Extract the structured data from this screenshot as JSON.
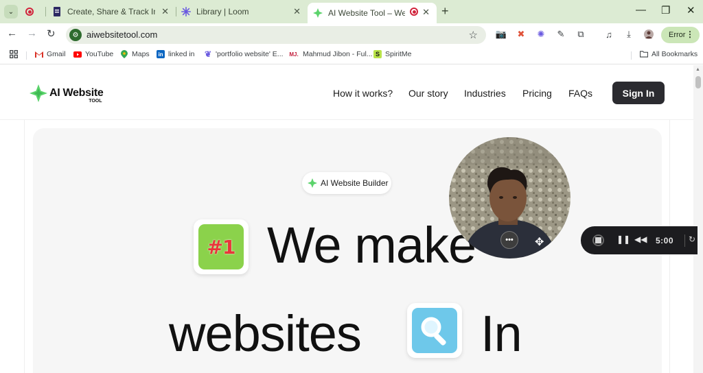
{
  "tabs": [
    {
      "label": "",
      "icon": "loom-record-icon"
    },
    {
      "label": "Create, Share & Track Invoices",
      "icon": "invoice-app-icon"
    },
    {
      "label": "Library | Loom",
      "icon": "loom-icon"
    },
    {
      "label": "AI Website Tool – Website B",
      "icon": "ai-website-icon",
      "active": true
    }
  ],
  "toolbar": {
    "url": "aiwebsitetool.com",
    "error_label": "Error"
  },
  "bookmarks": [
    {
      "label": "Gmail",
      "icon": "gmail-icon"
    },
    {
      "label": "YouTube",
      "icon": "youtube-icon"
    },
    {
      "label": "Maps",
      "icon": "maps-icon"
    },
    {
      "label": "linked in",
      "icon": "linkedin-icon"
    },
    {
      "label": "'portfolio website' E...",
      "icon": "feather-icon"
    },
    {
      "label": "Mahmud Jibon - Ful...",
      "icon": "mj-icon",
      "icon_text": "MJ."
    },
    {
      "label": "SpiritMe",
      "icon": "spiritme-icon",
      "icon_text": "S"
    }
  ],
  "all_bookmarks_label": "All Bookmarks",
  "site": {
    "logo_main": "AI Website",
    "logo_sub": "TOOL",
    "nav": [
      "How it works?",
      "Our story",
      "Industries",
      "Pricing",
      "FAQs"
    ],
    "signin_label": "Sign In",
    "hero_badge": "AI Website Builder",
    "headline_line1": "We make",
    "headline_line2_a": "websites",
    "headline_line2_b": "In",
    "emoji1_text": "#1"
  },
  "recorder": {
    "time": "5:00"
  },
  "colors": {
    "tabstrip_bg": "#dcebd3",
    "brand_green": "#5bd36b",
    "signin_bg": "#2b2b30",
    "emoji_green": "#8bd24b",
    "emoji_blue": "#6ec8ea",
    "recorder_bg": "#1c1c1f"
  }
}
